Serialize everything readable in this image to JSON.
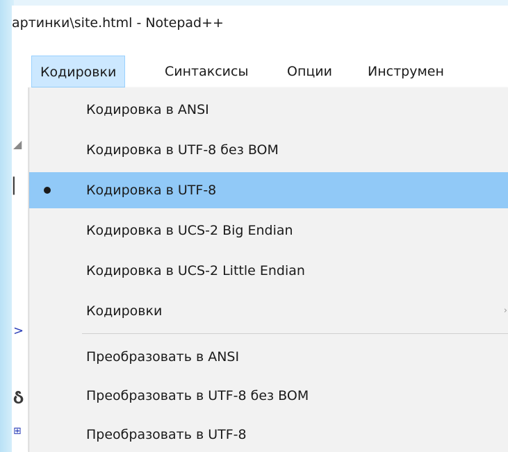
{
  "window": {
    "title": "артинки\\site.html - Notepad++"
  },
  "menubar": {
    "items": [
      {
        "label": "Кодировки",
        "active": true
      },
      {
        "label": "Синтаксисы",
        "active": false
      },
      {
        "label": "Опции",
        "active": false
      },
      {
        "label": "Инструмен",
        "active": false
      }
    ]
  },
  "dropdown": {
    "items": [
      {
        "label": "Кодировка в ANSI"
      },
      {
        "label": "Кодировка в UTF-8 без BOM"
      },
      {
        "label": "Кодировка в UTF-8",
        "checked": true,
        "highlighted": true
      },
      {
        "label": "Кодировка в UCS-2 Big Endian"
      },
      {
        "label": "Кодировка в UCS-2 Little Endian"
      },
      {
        "label": "Кодировки",
        "submenu": true
      },
      {
        "label": "Преобразовать в ANSI"
      },
      {
        "label": "Преобразовать в UTF-8 без BOM"
      },
      {
        "label": "Преобразовать в UTF-8"
      }
    ]
  },
  "colors": {
    "highlight": "#91c9f7",
    "menu_active": "#cce8ff",
    "dropdown_bg": "#f2f2f2"
  }
}
